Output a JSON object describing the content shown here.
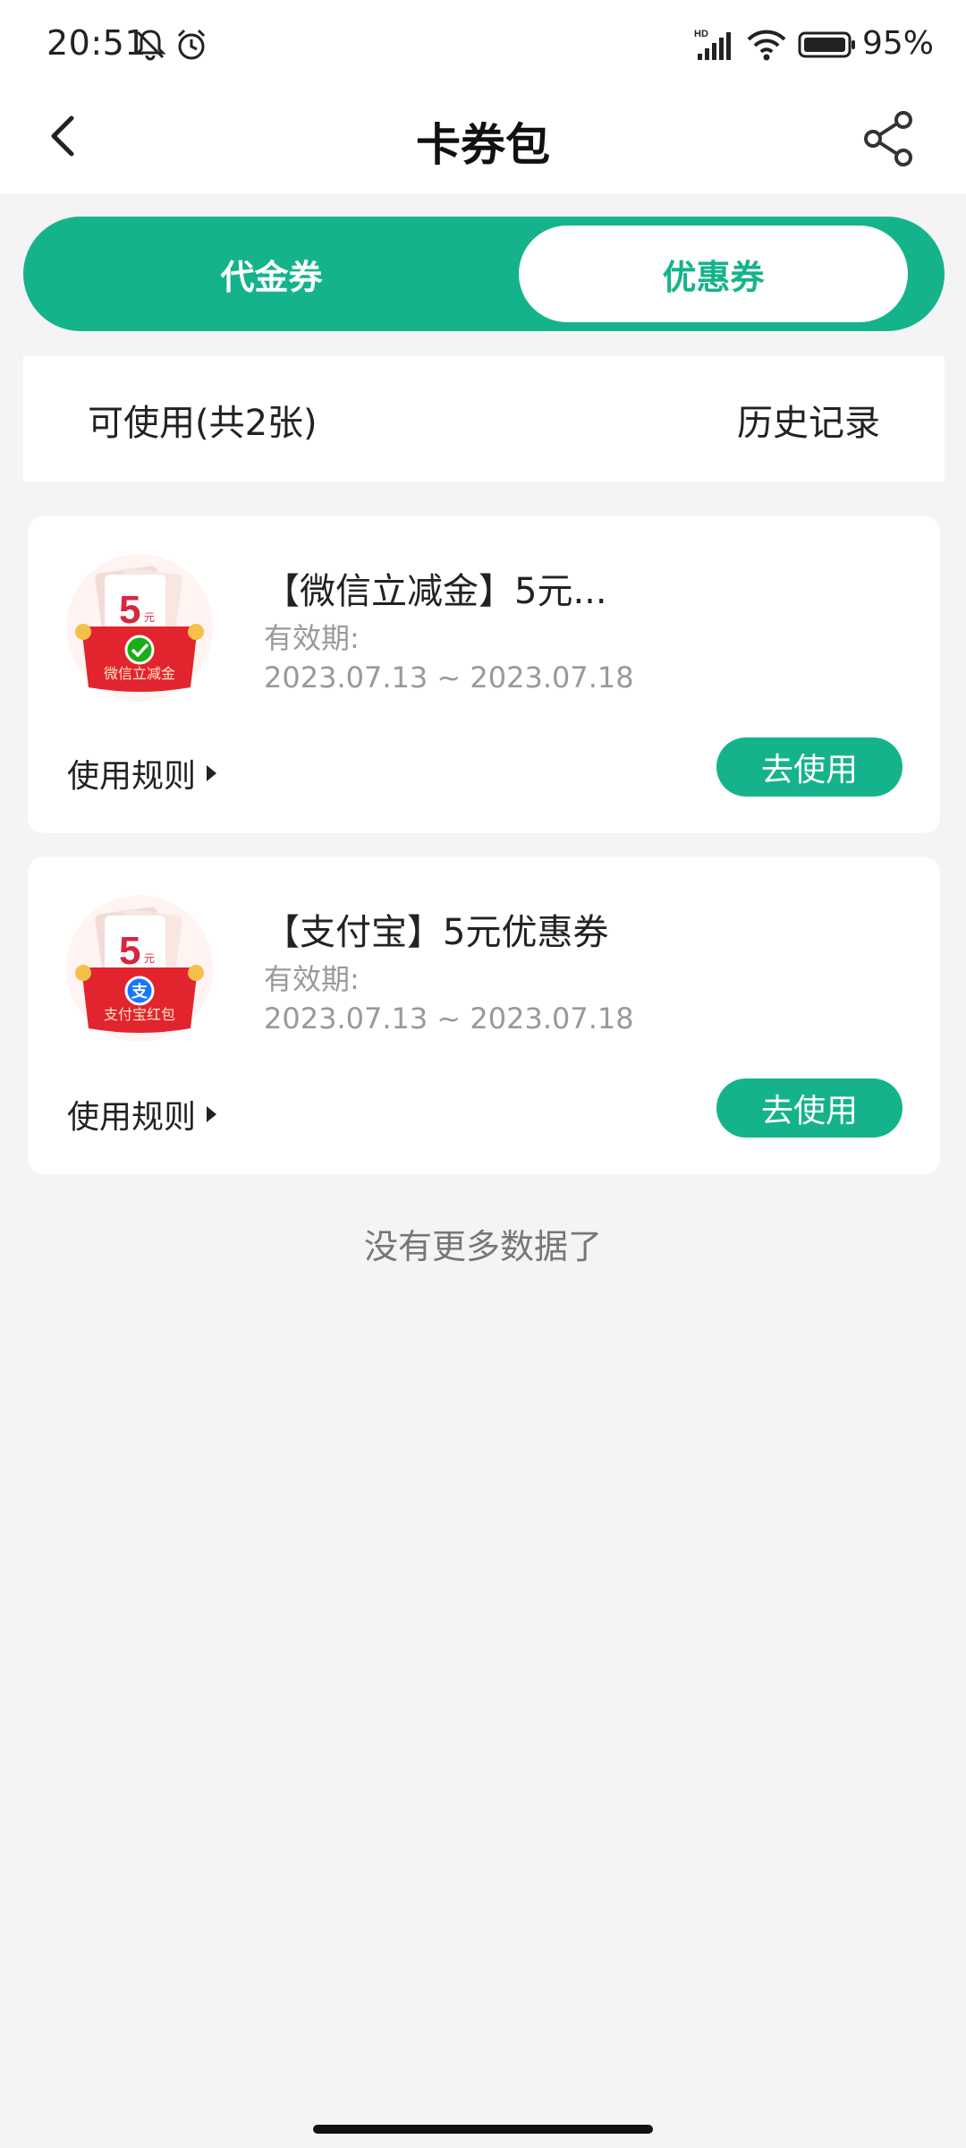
{
  "status_bar": {
    "time": "20:51",
    "icons": [
      "mute-bell-icon",
      "alarm-icon",
      "hd-signal-icon",
      "wifi-icon",
      "battery-icon"
    ],
    "battery": "95%"
  },
  "header": {
    "title": "卡券包",
    "back_icon": "chevron-left-icon",
    "share_icon": "share-icon"
  },
  "tabs": [
    {
      "label": "代金券",
      "selected": false
    },
    {
      "label": "优惠券",
      "selected": true
    }
  ],
  "subbar": {
    "available": "可使用(共2张)",
    "history": "历史记录"
  },
  "coupons": [
    {
      "title": "【微信立减金】5元...",
      "valid_label": "有效期:",
      "valid_range": "2023.07.13 ~ 2023.07.18",
      "rules_label": "使用规则",
      "use_label": "去使用",
      "badge_value": "5",
      "badge_unit": "元",
      "badge_text": "微信立减金"
    },
    {
      "title": "【支付宝】5元优惠券",
      "valid_label": "有效期:",
      "valid_range": "2023.07.13 ~ 2023.07.18",
      "rules_label": "使用规则",
      "use_label": "去使用",
      "badge_value": "5",
      "badge_unit": "元",
      "badge_text": "支付宝红包"
    }
  ],
  "footer": {
    "no_more": "没有更多数据了"
  },
  "colors": {
    "accent": "#15b38b",
    "background": "#f4f4f4"
  }
}
